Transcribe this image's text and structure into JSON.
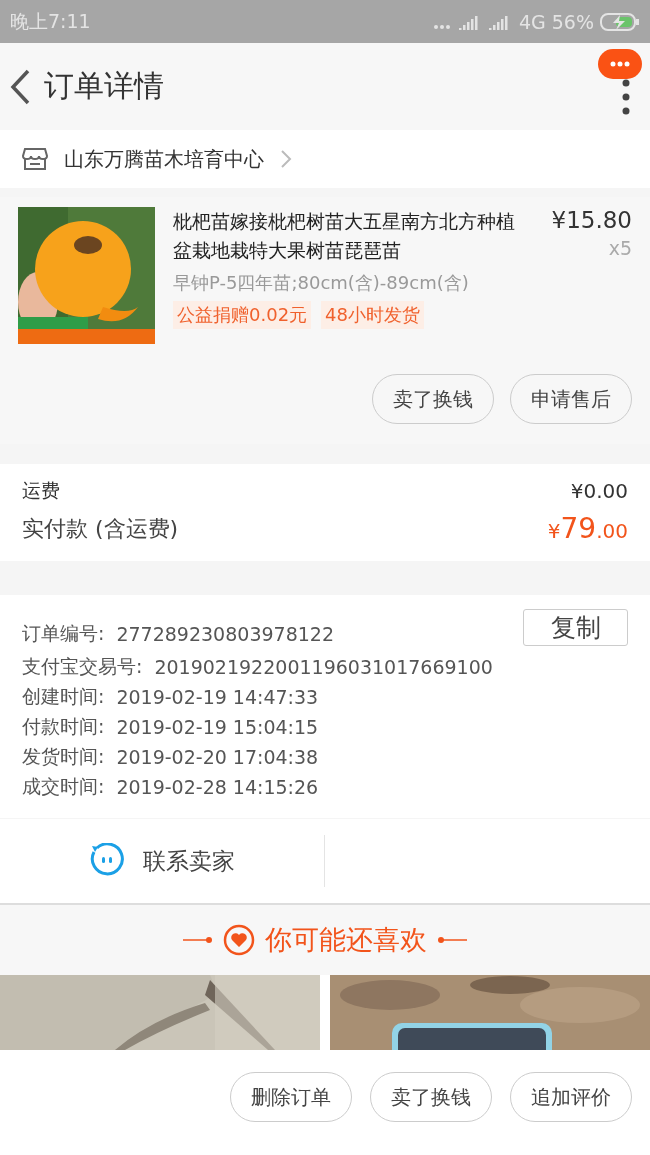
{
  "status_bar": {
    "time": "晚上7:11",
    "network": "4G",
    "battery": "56%",
    "charging": true
  },
  "header": {
    "title": "订单详情"
  },
  "shop": {
    "name": "山东万腾苗木培育中心"
  },
  "item": {
    "title": "枇杷苗嫁接枇杷树苗大五星南方北方种植盆栽地栽特大果树苗琵琶苗",
    "price": "¥15.80",
    "quantity": "x5",
    "spec": "早钟P-5四年苗;80cm(含)-89cm(含)",
    "tags": [
      "公益捐赠0.02元",
      "48小时发货"
    ],
    "actions": [
      "卖了换钱",
      "申请售后"
    ]
  },
  "fees": [
    {
      "label": "运费",
      "value": "¥0.00"
    }
  ],
  "total": {
    "label": "实付款 (含运费)",
    "currency": "¥",
    "whole": "79",
    "fraction": ".00"
  },
  "order_info": {
    "copy_button": "复制",
    "rows": [
      {
        "label": "订单编号:",
        "value": "277289230803978122"
      },
      {
        "label": "支付宝交易号:",
        "value": "2019021922001196031017669100"
      },
      {
        "label": "创建时间:",
        "value": "2019-02-19 14:47:33"
      },
      {
        "label": "付款时间:",
        "value": "2019-02-19 15:04:15"
      },
      {
        "label": "发货时间:",
        "value": "2019-02-20 17:04:38"
      },
      {
        "label": "成交时间:",
        "value": "2019-02-28 14:15:26"
      }
    ]
  },
  "contact": {
    "label": "联系卖家"
  },
  "recommend": {
    "title": "你可能还喜欢"
  },
  "bottom_actions": [
    "删除订单",
    "卖了换钱",
    "追加评价"
  ]
}
